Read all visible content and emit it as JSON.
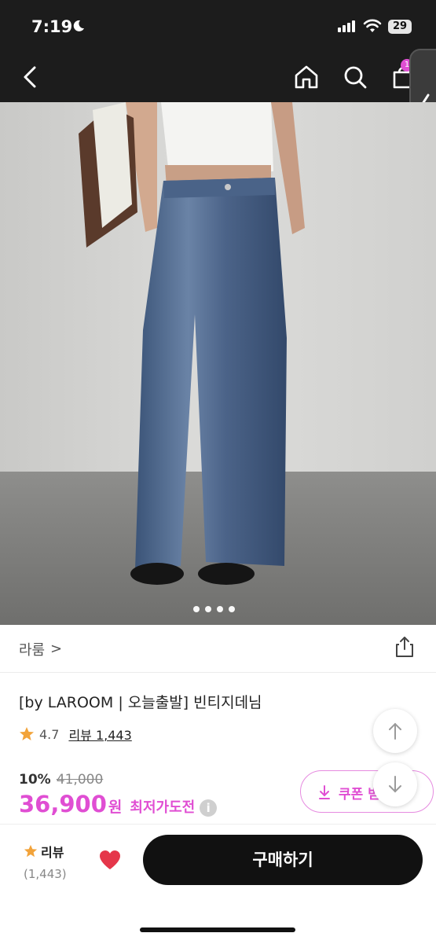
{
  "status": {
    "time": "7:19",
    "battery": "29"
  },
  "nav": {
    "cart_badge": "1"
  },
  "gallery": {
    "page_dots": 4,
    "active_dot": 0
  },
  "brand": {
    "name": "라룸",
    "chevron": ">"
  },
  "product": {
    "title": "[by LAROOM | 오늘출발] 빈티지데님",
    "rating": "4.7",
    "review_link": "리뷰 1,443",
    "discount_rate": "10%",
    "original_price": "41,000",
    "sale_price": "36,900",
    "currency": "원",
    "lowest_price_label": "최저가도전",
    "info_icon": "i"
  },
  "coupon": {
    "label": "쿠폰 받"
  },
  "bottom": {
    "review_label": "리뷰",
    "review_count": "(1,443)",
    "buy_label": "구매하기"
  },
  "colors": {
    "accent": "#e04ed3",
    "star": "#f2a33a",
    "heart": "#e5364a",
    "dark": "#1c1c1c"
  }
}
